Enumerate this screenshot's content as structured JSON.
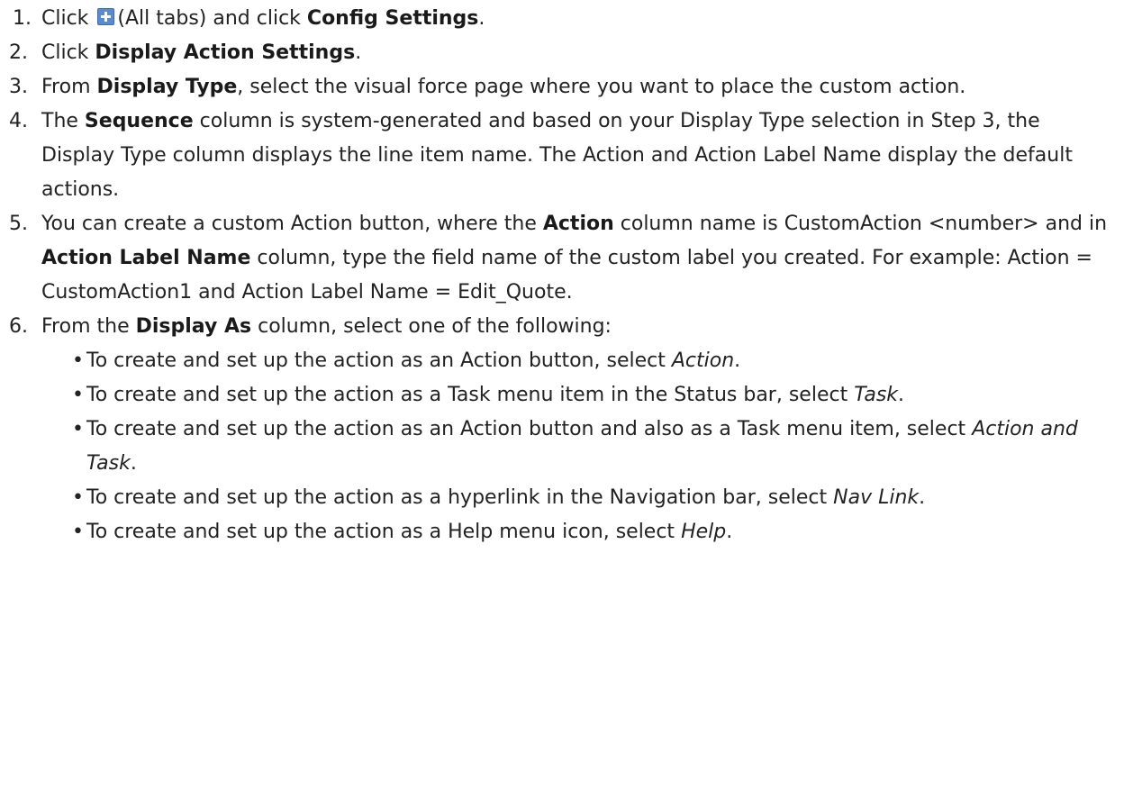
{
  "steps": [
    {
      "number": "1.",
      "parts": [
        "Click",
        "(All tabs) and click",
        "Config Settings",
        "."
      ]
    },
    {
      "number": "2.",
      "parts": [
        "Click",
        "Display Action Settings",
        "."
      ]
    },
    {
      "number": "3.",
      "parts": [
        "From",
        "Display Type",
        ", select the visual force page where you want to place the custom action."
      ]
    },
    {
      "number": "4.",
      "parts": [
        "The",
        "Sequence",
        "column is system-generated and based on your Display Type selection in Step 3, the Display Type column displays the line item name. The Action and Action Label Name display the default actions."
      ]
    },
    {
      "number": "5.",
      "parts": [
        "You can create a custom Action button, where the",
        "Action",
        "column name is CustomAction <number> and in",
        "Action Label Name",
        "column, type the field name of the custom label you created. For example: Action = CustomAction1 and Action Label Name = Edit_Quote."
      ]
    },
    {
      "number": "6.",
      "parts": [
        "From the",
        "Display As",
        "column, select one of the following:"
      ]
    }
  ],
  "bullets": [
    {
      "text": "To create and set up the action as an Action button, select",
      "option": "Action",
      "end": "."
    },
    {
      "text": "To create and set up the action as a Task menu item in the Status bar, select",
      "option": "Task",
      "end": "."
    },
    {
      "text": "To create and set up the action as an Action button and also as a Task menu item, select",
      "option": "Action and Task",
      "end": "."
    },
    {
      "text": "To create and set up the action as a hyperlink in the Navigation bar, select",
      "option": "Nav Link",
      "end": "."
    },
    {
      "text": "To create and set up the action as a Help menu icon, select",
      "option": "Help",
      "end": "."
    }
  ],
  "bullet_glyph": "•",
  "icons": {
    "all_tabs": "plus-tab-icon",
    "all_tabs_color": "#5a8ad2"
  }
}
